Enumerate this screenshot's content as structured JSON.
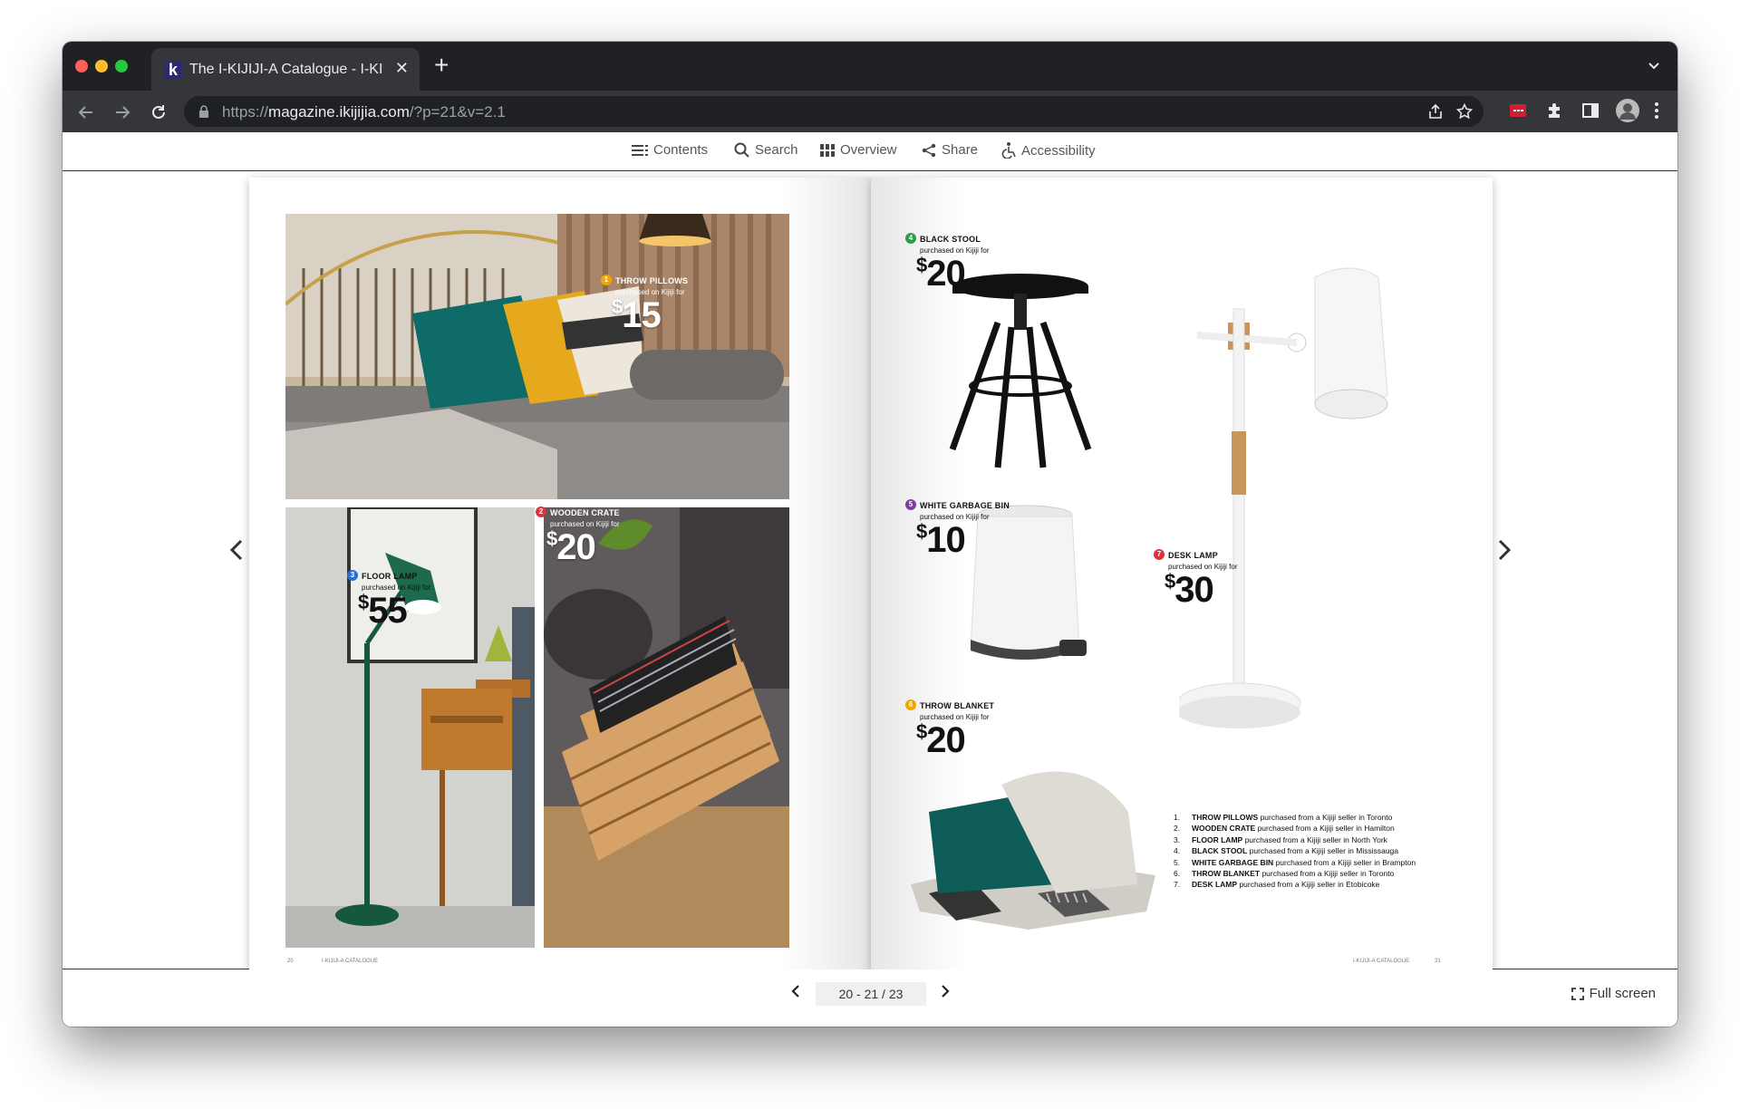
{
  "browser": {
    "tab_title": "The I-KIJIJI-A Catalogue - I-KI",
    "url_scheme": "https://",
    "url_host": "magazine.ikijijia.com",
    "url_path": "/?p=21&v=2.1",
    "favicon_letter": "k",
    "new_tab_symbol": "+",
    "close_symbol": "✕"
  },
  "viewer_toolbar": {
    "contents": "Contents",
    "search": "Search",
    "overview": "Overview",
    "share": "Share",
    "accessibility": "Accessibility"
  },
  "left_page": {
    "products": [
      {
        "num": "1",
        "name": "THROW PILLOWS",
        "sub": "purchased on Kijiji for",
        "price": "15",
        "color": "#f0a500"
      },
      {
        "num": "2",
        "name": "WOODEN CRATE",
        "sub": "purchased on Kijiji for",
        "price": "20",
        "color": "#e0323a"
      },
      {
        "num": "3",
        "name": "FLOOR LAMP",
        "sub": "purchased on Kijiji for",
        "price": "55",
        "color": "#2a6fd6"
      }
    ],
    "folio_number": "20",
    "folio_title": "I-KIJIJI-A CATALOGUE"
  },
  "right_page": {
    "products": [
      {
        "num": "4",
        "name": "BLACK STOOL",
        "sub": "purchased on Kijiji for",
        "price": "20",
        "color": "#2e9d4a"
      },
      {
        "num": "5",
        "name": "WHITE GARBAGE BIN",
        "sub": "purchased on Kijiji for",
        "price": "10",
        "color": "#7b3fa0"
      },
      {
        "num": "6",
        "name": "THROW BLANKET",
        "sub": "purchased on Kijiji for",
        "price": "20",
        "color": "#f0a500"
      },
      {
        "num": "7",
        "name": "DESK LAMP",
        "sub": "purchased on Kijiji for",
        "price": "30",
        "color": "#e0323a"
      }
    ],
    "credits": [
      {
        "n": "1.",
        "item": "THROW PILLOWS",
        "text": "purchased from a Kijiji seller in Toronto"
      },
      {
        "n": "2.",
        "item": "WOODEN CRATE",
        "text": "purchased from a Kijiji seller in Hamilton"
      },
      {
        "n": "3.",
        "item": "FLOOR LAMP",
        "text": "purchased from a Kijiji seller in North York"
      },
      {
        "n": "4.",
        "item": "BLACK STOOL",
        "text": "purchased from a Kijiji seller in Mississauga"
      },
      {
        "n": "5.",
        "item": "WHITE GARBAGE BIN",
        "text": "purchased from a Kijiji seller in Brampton"
      },
      {
        "n": "6.",
        "item": "THROW BLANKET",
        "text": "purchased from a Kijiji seller in Toronto"
      },
      {
        "n": "7.",
        "item": "DESK LAMP",
        "text": "purchased from a Kijiji seller in Etobicoke"
      }
    ],
    "folio_title": "I-KIJIJI-A CATALOGUE",
    "folio_number": "21"
  },
  "pagination": {
    "indicator": "20 - 21 / 23",
    "fullscreen": "Full screen"
  },
  "currency_symbol": "$",
  "icons": {
    "back": "arrow-left-icon",
    "forward": "arrow-right-icon",
    "reload": "reload-icon",
    "lock": "lock-icon",
    "share": "share-icon",
    "star": "star-icon",
    "extension": "puzzle-icon",
    "sidepanel": "sidepanel-icon",
    "menu": "kebab-menu-icon"
  },
  "colors": {
    "chrome_dark": "#202124",
    "chrome_toolbar": "#35363a",
    "traffic_red": "#ff5f57",
    "traffic_yellow": "#febc2e",
    "traffic_green": "#28c840"
  }
}
